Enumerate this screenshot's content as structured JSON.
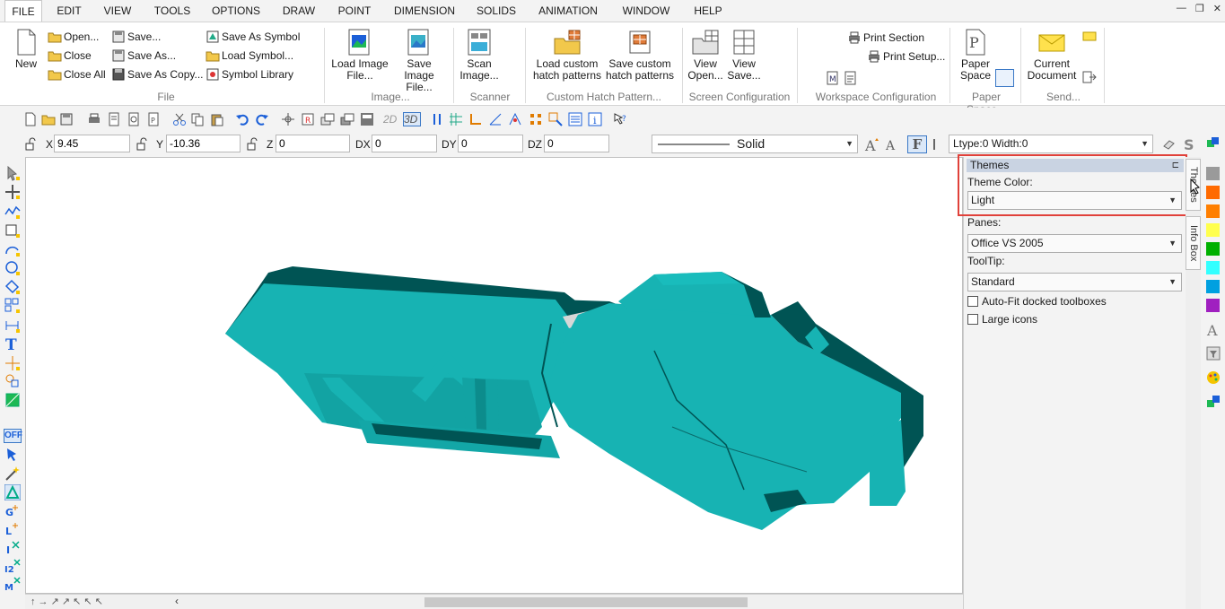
{
  "menu": {
    "items": [
      "FILE",
      "EDIT",
      "VIEW",
      "TOOLS",
      "OPTIONS",
      "DRAW",
      "POINT",
      "DIMENSION",
      "SOLIDS",
      "ANIMATION",
      "WINDOW",
      "HELP"
    ],
    "active": "FILE"
  },
  "window_controls": {
    "minimize": "—",
    "restore": "❐",
    "close": "✕"
  },
  "ribbon": {
    "file": {
      "new": "New",
      "open": "Open...",
      "close": "Close",
      "close_all": "Close All",
      "save": "Save...",
      "save_as": "Save As...",
      "save_as_copy": "Save As Copy...",
      "save_as_symbol": "Save As Symbol",
      "load_symbol": "Load Symbol...",
      "symbol_library": "Symbol Library",
      "group": "File"
    },
    "image": {
      "load_line1": "Load Image",
      "load_line2": "File...",
      "save_line1": "Save Image",
      "save_line2": "File...",
      "group": "Image..."
    },
    "scanner": {
      "line1": "Scan",
      "line2": "Image...",
      "group": "Scanner"
    },
    "hatch": {
      "load_line1": "Load custom",
      "load_line2": "hatch patterns",
      "save_line1": "Save custom",
      "save_line2": "hatch patterns",
      "group": "Custom Hatch Pattern..."
    },
    "screen": {
      "open_line1": "View",
      "open_line2": "Open...",
      "save_line1": "View",
      "save_line2": "Save...",
      "group": "Screen Configuration"
    },
    "workspace": {
      "print_section": "Print Section",
      "print_setup": "Print Setup...",
      "group": "Workspace Configuration"
    },
    "paper": {
      "line1": "Paper",
      "line2": "Space",
      "group": "Paper Space..."
    },
    "send": {
      "line1": "Current",
      "line2": "Document",
      "group": "Send..."
    }
  },
  "toolbar": {
    "mode_2d": "2D",
    "mode_3d": "3D"
  },
  "coords": {
    "x_label": "X",
    "x_value": "9.45",
    "y_label": "Y",
    "y_value": "-10.36",
    "z_label": "Z",
    "z_value": "0",
    "dx_label": "DX",
    "dx_value": "0",
    "dy_label": "DY",
    "dy_value": "0",
    "dz_label": "DZ",
    "dz_value": "0"
  },
  "line_style": {
    "value": "Solid"
  },
  "ltype": {
    "value": "Ltype:0  Width:0"
  },
  "left_tools": {
    "off_label": "OFF"
  },
  "panel": {
    "title": "Themes",
    "theme_color_label": "Theme Color:",
    "theme_color_value": "Light",
    "panes_label": "Panes:",
    "panes_value": "Office VS 2005",
    "tooltip_label": "ToolTip:",
    "tooltip_value": "Standard",
    "autofit_label": "Auto-Fit docked toolboxes",
    "large_icons_label": "Large icons"
  },
  "vertical_tabs": {
    "themes": "Themes",
    "info_box": "Info Box"
  },
  "colors": {
    "accent_highlight": "#e0413a",
    "model_light": "#17b3b3",
    "model_dark": "#005454",
    "swatches": [
      "#9a9a9a",
      "#ff6a00",
      "#ff7f00",
      "#ffff4d",
      "#00b000",
      "#33ffff",
      "#00a0e0",
      "#a020c0"
    ]
  }
}
